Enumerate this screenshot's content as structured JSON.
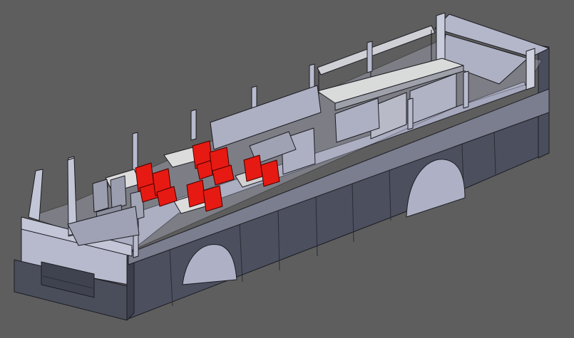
{
  "viewport": {
    "background": "#5e5e5e",
    "model": "bus-body-cad-model",
    "body_color": "#4d5160",
    "interior_color": "#b9bccf",
    "seat_color": "#e61a12",
    "table_color": "#dcdcdc"
  }
}
